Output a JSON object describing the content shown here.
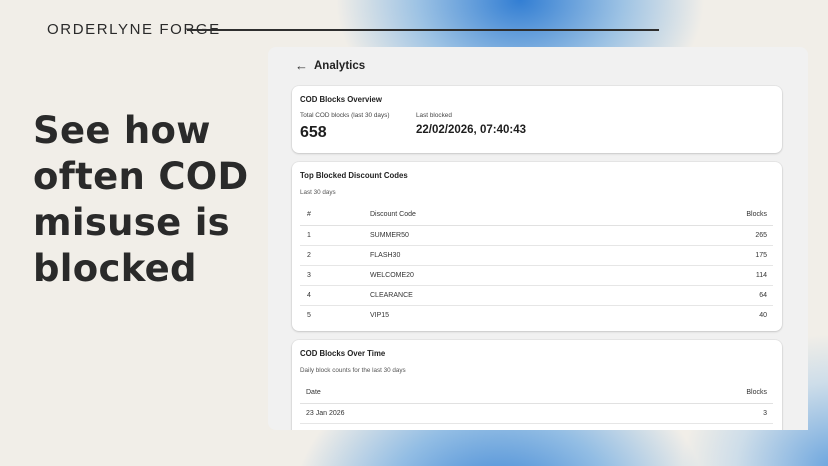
{
  "brand": {
    "name": "ORDERLYNE FORGE"
  },
  "hero": {
    "headline": "See how often COD misuse is blocked"
  },
  "app": {
    "page_title": "Analytics",
    "back_icon": "arrow-left-icon"
  },
  "overview": {
    "title": "COD Blocks Overview",
    "total_label": "Total COD blocks (last 30 days)",
    "total_value": "658",
    "last_blocked_label": "Last blocked",
    "last_blocked_value": "22/02/2026, 07:40:43"
  },
  "top_codes": {
    "title": "Top Blocked Discount Codes",
    "subtitle": "Last 30 days",
    "columns": {
      "rank": "#",
      "code": "Discount Code",
      "blocks": "Blocks"
    },
    "rows": [
      {
        "rank": "1",
        "code": "SUMMER50",
        "blocks": "265"
      },
      {
        "rank": "2",
        "code": "FLASH30",
        "blocks": "175"
      },
      {
        "rank": "3",
        "code": "WELCOME20",
        "blocks": "114"
      },
      {
        "rank": "4",
        "code": "CLEARANCE",
        "blocks": "64"
      },
      {
        "rank": "5",
        "code": "VIP15",
        "blocks": "40"
      }
    ]
  },
  "over_time": {
    "title": "COD Blocks Over Time",
    "subtitle": "Daily block counts for the last 30 days",
    "columns": {
      "date": "Date",
      "blocks": "Blocks"
    },
    "rows": [
      {
        "date": "23 Jan 2026",
        "blocks": "3"
      }
    ]
  },
  "colors": {
    "background": "#f2efe9",
    "accent_blue": "#2878d2",
    "panel": "#f1f1f1",
    "card": "#ffffff"
  }
}
